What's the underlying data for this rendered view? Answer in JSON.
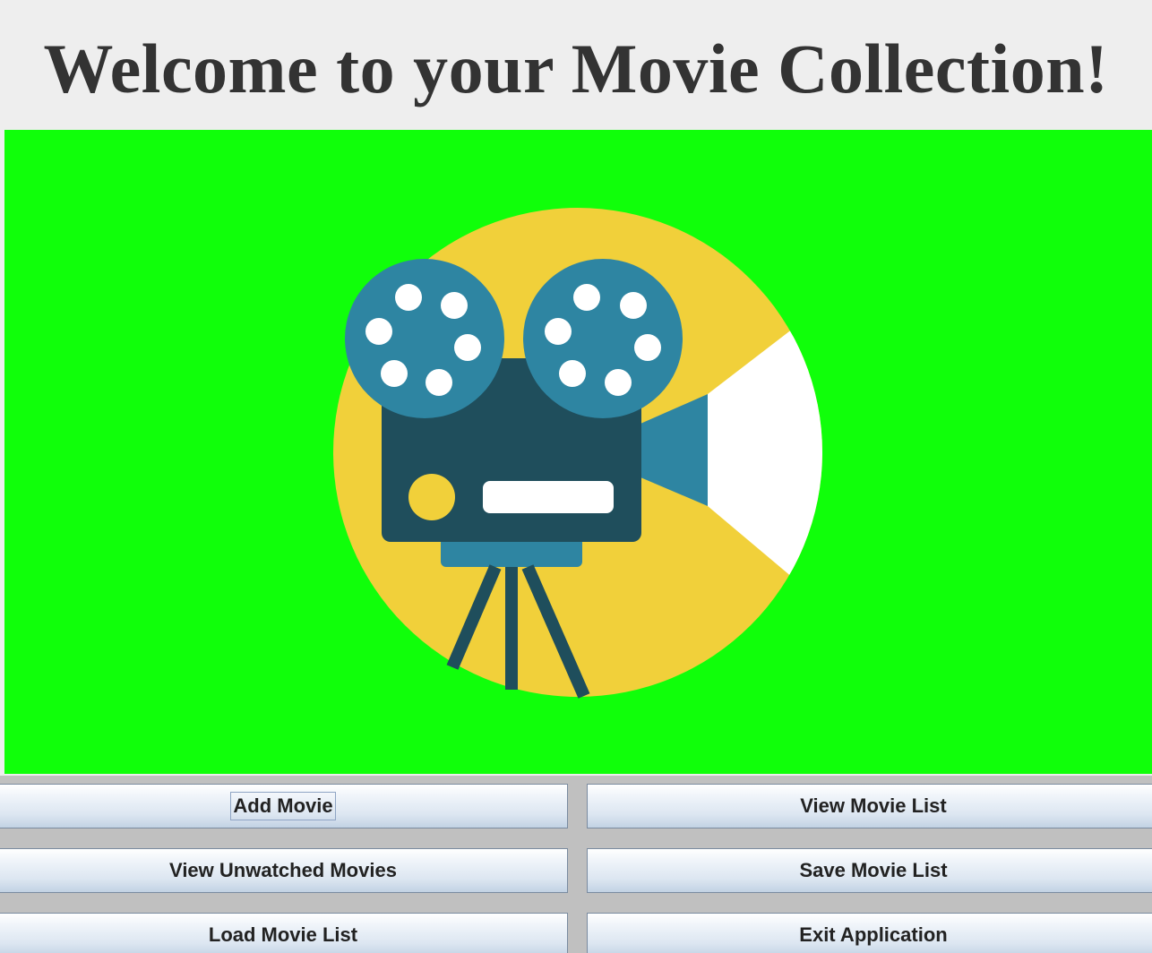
{
  "header": {
    "title": "Welcome to your Movie Collection!"
  },
  "banner": {
    "image": "movie-projector-illustration",
    "colors": {
      "background": "#10ff0a",
      "circle": "#f1d03a",
      "reel": "#2e85a2",
      "body": "#1f4e5c",
      "light": "#ffffff"
    }
  },
  "buttons": {
    "add_movie": "Add Movie",
    "view_movie_list": "View Movie List",
    "view_unwatched": "View Unwatched Movies",
    "save_movie_list": "Save Movie List",
    "load_movie_list": "Load Movie List",
    "exit_application": "Exit Application"
  }
}
